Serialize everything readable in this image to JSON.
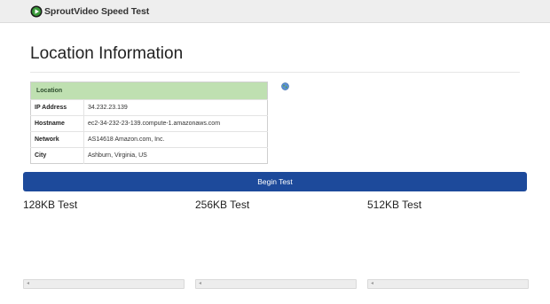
{
  "header": {
    "app_name": "SproutVideo Speed Test",
    "logo_icon": "play-icon"
  },
  "main": {
    "title": "Location Information",
    "globe_icon": "globe-icon",
    "location_table": {
      "header": "Location",
      "rows": [
        {
          "label": "IP Address",
          "value": "34.232.23.139"
        },
        {
          "label": "Hostname",
          "value": "ec2-34-232-23-139.compute-1.amazonaws.com"
        },
        {
          "label": "Network",
          "value": "AS14618 Amazon.com, Inc."
        },
        {
          "label": "City",
          "value": "Ashburn, Virginia, US"
        }
      ]
    },
    "begin_button": "Begin Test",
    "tests": [
      {
        "title": "128KB Test",
        "progress": 0.0
      },
      {
        "title": "256KB Test",
        "progress": 0.0
      },
      {
        "title": "512KB Test",
        "progress": 0.0
      }
    ]
  },
  "colors": {
    "header_bg": "#eeeeee",
    "table_header_bg": "#bfe0b1",
    "button_bg": "#1d4a9b",
    "logo_green": "#2e7d32"
  }
}
